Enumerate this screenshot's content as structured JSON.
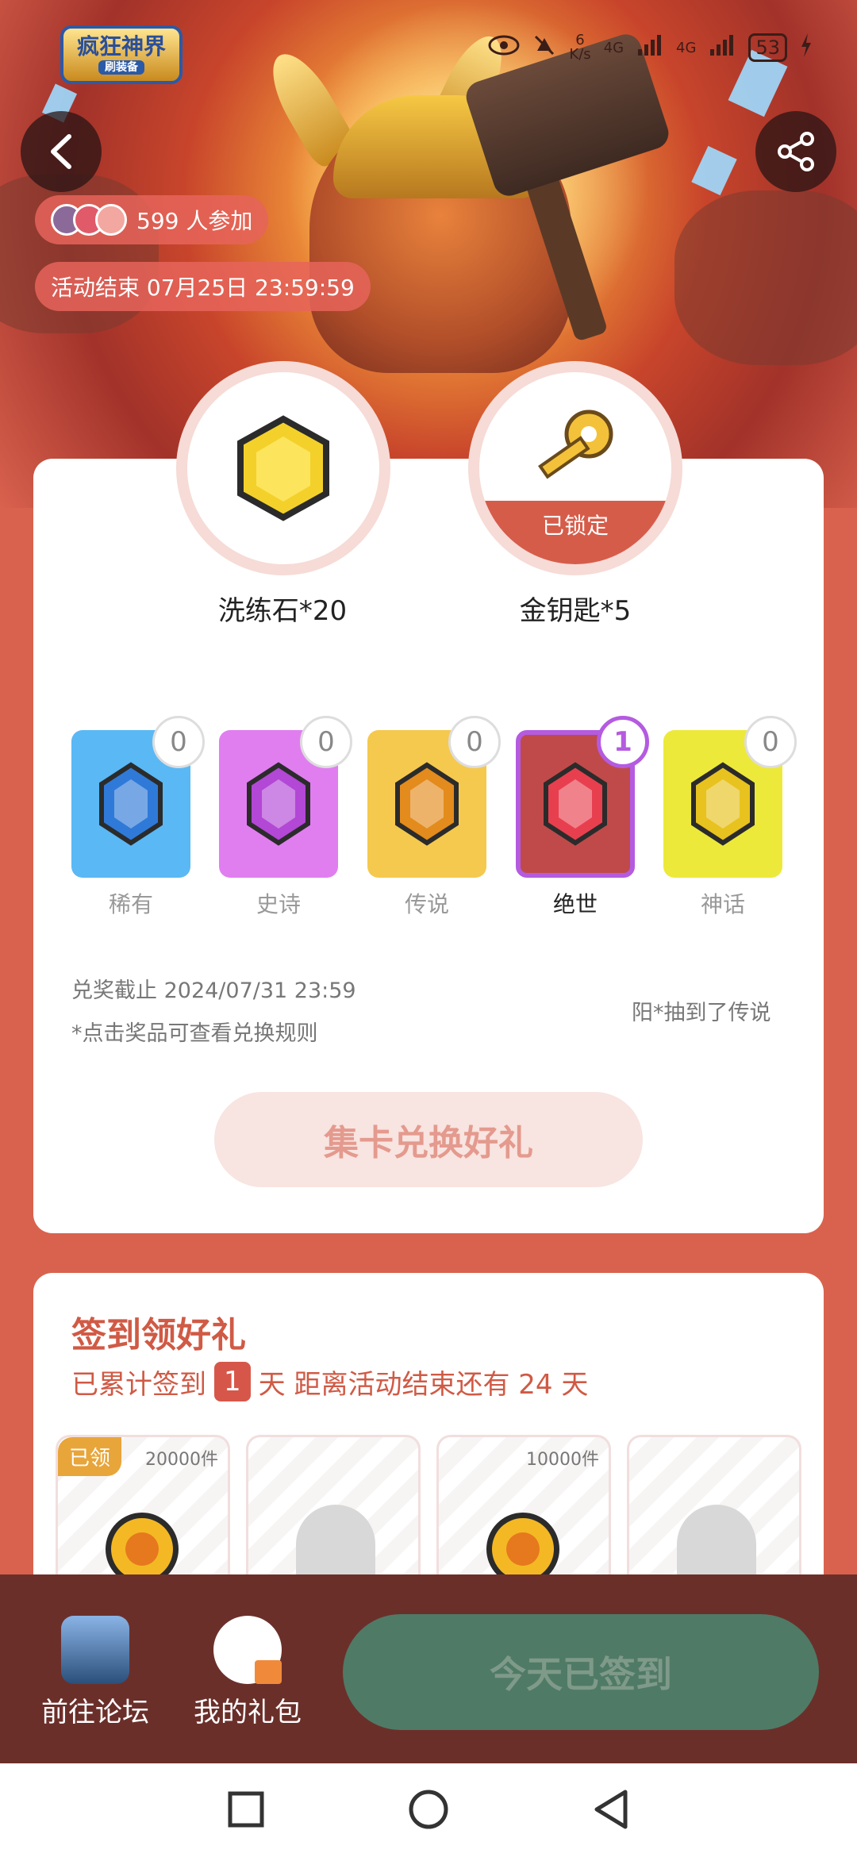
{
  "status_bar": {
    "net_speed_value": "6",
    "net_speed_unit": "K/s",
    "network_1": "4G",
    "network_2": "4G",
    "battery": "53"
  },
  "game_logo": {
    "title": "疯狂神界",
    "subtitle": "刷装备"
  },
  "participants": {
    "text": "599 人参加"
  },
  "activity_end": {
    "text": "活动结束 07月25日 23:59:59"
  },
  "prizes": [
    {
      "name": "洗练石*20",
      "locked": false,
      "locked_label": ""
    },
    {
      "name": "金钥匙*5",
      "locked": true,
      "locked_label": "已锁定"
    }
  ],
  "cards": [
    {
      "label": "稀有",
      "count": "0",
      "color": "#5ab8f5",
      "gem": "#2f7ad8",
      "selected": false
    },
    {
      "label": "史诗",
      "count": "0",
      "color": "#e07ef0",
      "gem": "#b347d6",
      "selected": false
    },
    {
      "label": "传说",
      "count": "0",
      "color": "#f5c94e",
      "gem": "#e38b1c",
      "selected": false
    },
    {
      "label": "绝世",
      "count": "1",
      "color": "#c04a4a",
      "gem": "#e83f4f",
      "selected": true
    },
    {
      "label": "神话",
      "count": "0",
      "color": "#ede93a",
      "gem": "#e8c21e",
      "selected": false
    }
  ],
  "redeem": {
    "deadline": "兑奖截止 2024/07/31 23:59",
    "rule_hint": "*点击奖品可查看兑换规则",
    "ticker": "阳*抽到了传说",
    "button": "集卡兑换好礼"
  },
  "signin": {
    "title": "签到领好礼",
    "prefix": "已累计签到",
    "days": "1",
    "suffix": "天  距离活动结束还有 24 天",
    "rewards": [
      {
        "tag": "已领",
        "qty": "20000件",
        "type": "coin"
      },
      {
        "tag": "",
        "qty": "",
        "type": "locked"
      },
      {
        "tag": "",
        "qty": "10000件",
        "type": "coin"
      },
      {
        "tag": "",
        "qty": "",
        "type": "locked"
      }
    ]
  },
  "bottom_bar": {
    "forum_label": "前往论坛",
    "gift_label": "我的礼包",
    "signed_button": "今天已签到"
  }
}
